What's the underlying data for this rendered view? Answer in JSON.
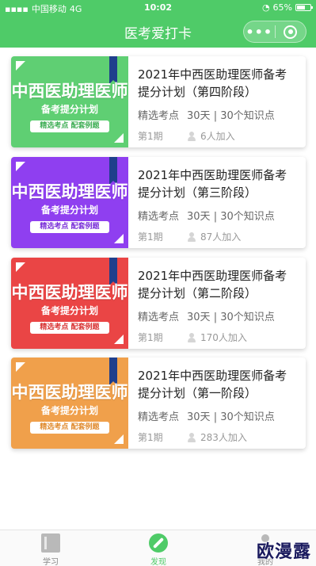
{
  "status_bar": {
    "carrier": "中国移动",
    "network": "4G",
    "time": "10:02",
    "battery_text": "65%",
    "battery_level": 0.65
  },
  "nav": {
    "title": "医考爱打卡",
    "more_glyph": "•••"
  },
  "courses": [
    {
      "cover": {
        "main_title": "中西医助理医师",
        "sub_title": "备考提分计划",
        "tags": "精选考点  配套例题",
        "bg_color": "#5fcf73",
        "tag_text_color": "#3fae55"
      },
      "title": "2021年中西医助理医师备考提分计划（第四阶段）",
      "points": "精选考点",
      "duration": "30天",
      "knowledge": "30个知识点",
      "period": "第1期",
      "joined": "6人加入"
    },
    {
      "cover": {
        "main_title": "中西医助理医师",
        "sub_title": "备考提分计划",
        "tags": "精选考点  配套例题",
        "bg_color": "#8f3ff0",
        "tag_text_color": "#7a2fd8"
      },
      "title": "2021年中西医助理医师备考提分计划（第三阶段）",
      "points": "精选考点",
      "duration": "30天",
      "knowledge": "30个知识点",
      "period": "第1期",
      "joined": "87人加入"
    },
    {
      "cover": {
        "main_title": "中西医助理医师",
        "sub_title": "备考提分计划",
        "tags": "精选考点  配套例题",
        "bg_color": "#ea4545",
        "tag_text_color": "#d83434"
      },
      "title": "2021年中西医助理医师备考提分计划（第二阶段）",
      "points": "精选考点",
      "duration": "30天",
      "knowledge": "30个知识点",
      "period": "第1期",
      "joined": "170人加入"
    },
    {
      "cover": {
        "main_title": "中西医助理医师",
        "sub_title": "备考提分计划",
        "tags": "精选考点  配套例题",
        "bg_color": "#f0a04b",
        "tag_text_color": "#e08b2f"
      },
      "title": "2021年中西医助理医师备考提分计划（第一阶段）",
      "points": "精选考点",
      "duration": "30天",
      "knowledge": "30个知识点",
      "period": "第1期",
      "joined": "283人加入"
    }
  ],
  "tab_bar": {
    "tabs": [
      {
        "label": "学习",
        "icon": "book-icon"
      },
      {
        "label": "发现",
        "icon": "compass-icon"
      },
      {
        "label": "我的",
        "icon": "person-icon"
      }
    ],
    "active_color": "#4fcb68"
  },
  "watermark": "欧漫露",
  "theme": {
    "primary": "#4fcb68"
  }
}
